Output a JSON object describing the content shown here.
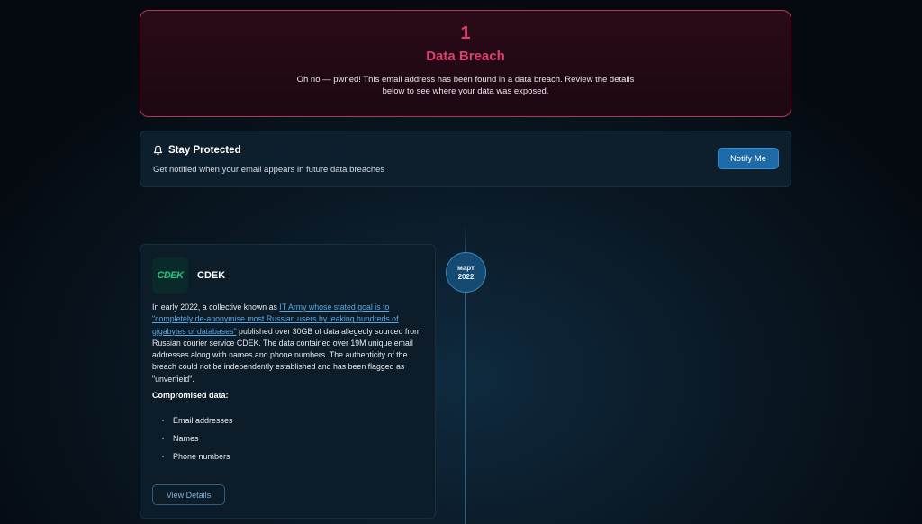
{
  "banner": {
    "count": "1",
    "title": "Data Breach",
    "description": "Oh no — pwned! This email address has been found in a data breach. Review the details below to see where your data was exposed."
  },
  "protect": {
    "icon": "bell-icon",
    "title": "Stay Protected",
    "description": "Get notified when your email appears in future data breaches",
    "button_label": "Notify Me"
  },
  "timeline": {
    "month": "март",
    "year": "2022"
  },
  "breach": {
    "logo_text": "CDEK",
    "name": "CDEK",
    "desc_part1": "In early 2022, a collective known as ",
    "desc_link": "IT Army whose stated goal is to \"completely de-anonymise most Russian users by leaking hundreds of gigabytes of databases\"",
    "desc_part2": " published over 30GB of data allegedly sourced from Russian courier service CDEK. The data contained over 19M unique email addresses along with names and phone numbers. The authenticity of the breach could not be independently established and has been flagged as \"unverfieid\".",
    "compromised_label": "Compromised data:",
    "compromised_items": [
      "Email addresses",
      "Names",
      "Phone numbers"
    ],
    "view_button_label": "View Details"
  },
  "colors": {
    "alert_accent": "#e0406e",
    "primary_button": "#1d6aa6",
    "link": "#5aa9e6",
    "logo_green": "#22c47a"
  }
}
